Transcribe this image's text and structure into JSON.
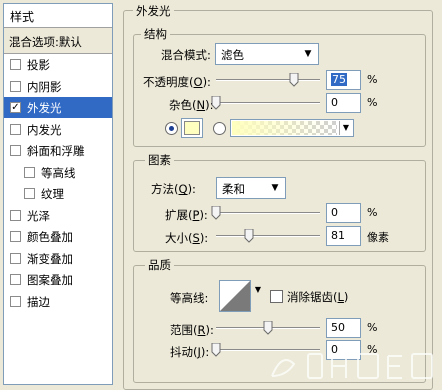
{
  "sidebar": {
    "title": "样式",
    "blend_options": "混合选项:默认",
    "items": [
      {
        "label": "投影",
        "checked": false,
        "selected": false,
        "indent": false
      },
      {
        "label": "内阴影",
        "checked": false,
        "selected": false,
        "indent": false
      },
      {
        "label": "外发光",
        "checked": true,
        "selected": true,
        "indent": false
      },
      {
        "label": "内发光",
        "checked": false,
        "selected": false,
        "indent": false
      },
      {
        "label": "斜面和浮雕",
        "checked": false,
        "selected": false,
        "indent": false
      },
      {
        "label": "等高线",
        "checked": false,
        "selected": false,
        "indent": true
      },
      {
        "label": "纹理",
        "checked": false,
        "selected": false,
        "indent": true
      },
      {
        "label": "光泽",
        "checked": false,
        "selected": false,
        "indent": false
      },
      {
        "label": "颜色叠加",
        "checked": false,
        "selected": false,
        "indent": false
      },
      {
        "label": "渐变叠加",
        "checked": false,
        "selected": false,
        "indent": false
      },
      {
        "label": "图案叠加",
        "checked": false,
        "selected": false,
        "indent": false
      },
      {
        "label": "描边",
        "checked": false,
        "selected": false,
        "indent": false
      }
    ],
    "checkmark": "✓"
  },
  "outer_glow": {
    "title": "外发光",
    "structure": {
      "title": "结构",
      "blend_mode": {
        "label": "混合模式:",
        "value": "滤色"
      },
      "opacity": {
        "label_prefix": "不透明度(",
        "key": "O",
        "label_suffix": "):",
        "value": "75",
        "unit": "%",
        "slider": 0.75
      },
      "noise": {
        "label_prefix": "杂色(",
        "key": "N",
        "label_suffix": "):",
        "value": "0",
        "unit": "%",
        "slider": 0
      },
      "color_mode": "solid",
      "glow_color": "#ffffc0"
    },
    "elements": {
      "title": "图素",
      "technique": {
        "label_prefix": "方法(",
        "key": "Q",
        "label_suffix": "):",
        "value": "柔和"
      },
      "spread": {
        "label_prefix": "扩展(",
        "key": "P",
        "label_suffix": "):",
        "value": "0",
        "unit": "%",
        "slider": 0
      },
      "size": {
        "label_prefix": "大小(",
        "key": "S",
        "label_suffix": "):",
        "value": "81",
        "unit": "像素",
        "slider": 0.32
      }
    },
    "quality": {
      "title": "品质",
      "contour": {
        "label": "等高线:"
      },
      "anti_alias": {
        "label_prefix": "消除锯齿(",
        "key": "L",
        "label_suffix": ")",
        "checked": false
      },
      "range": {
        "label_prefix": "范围(",
        "key": "R",
        "label_suffix": "):",
        "value": "50",
        "unit": "%",
        "slider": 0.5
      },
      "jitter": {
        "label_prefix": "抖动(",
        "key": "J",
        "label_suffix": "):",
        "value": "0",
        "unit": "%",
        "slider": 0
      }
    }
  },
  "colors": {
    "selection": "#316ac5",
    "field_border": "#7f9db9",
    "panel_bg": "#ece9d8"
  }
}
